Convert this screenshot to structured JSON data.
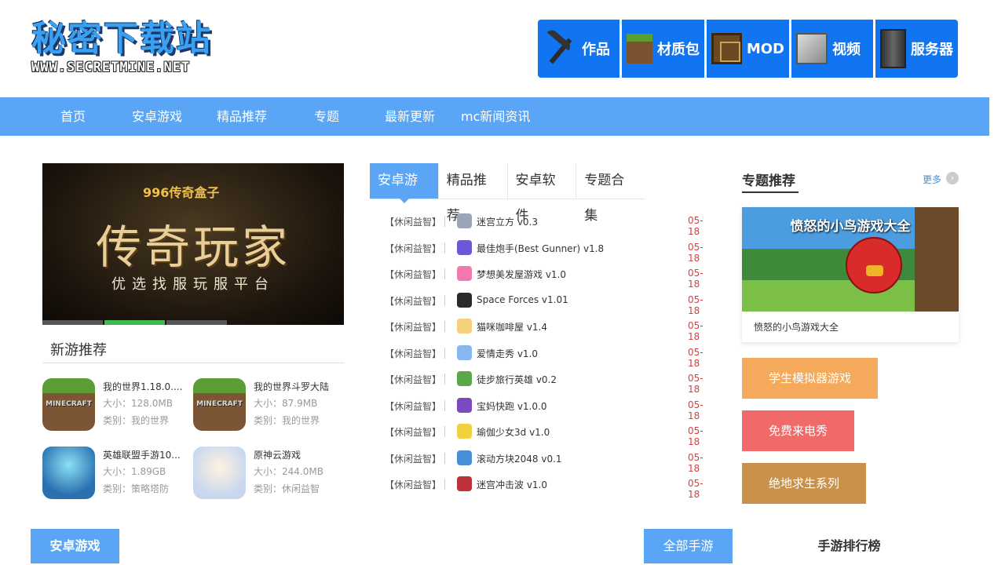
{
  "logo": {
    "main": "秘密下载站",
    "sub": "WWW.SECRETMINE.NET"
  },
  "top_categories": [
    {
      "label": "作品",
      "icon": "pickaxe-icon"
    },
    {
      "label": "材质包",
      "icon": "grass-block-icon"
    },
    {
      "label": "MOD",
      "icon": "book-icon"
    },
    {
      "label": "视频",
      "icon": "stone-block-icon"
    },
    {
      "label": "服务器",
      "icon": "server-icon"
    }
  ],
  "nav": [
    "首页",
    "安卓游戏",
    "精品推荐",
    "专题",
    "最新更新",
    "mc新闻资讯"
  ],
  "banner": {
    "brand": "996传奇盒子",
    "title": "传奇玩家",
    "subtitle": "优选找服玩服平台"
  },
  "new_games": {
    "title": "新游推荐",
    "items": [
      {
        "name": "我的世界1.18.0....",
        "size": "大小：128.0MB",
        "category": "类别：我的世界"
      },
      {
        "name": "我的世界斗罗大陆",
        "size": "大小：87.9MB",
        "category": "类别：我的世界"
      },
      {
        "name": "英雄联盟手游10...",
        "size": "大小：1.89GB",
        "category": "类别：策略塔防"
      },
      {
        "name": "原神云游戏",
        "size": "大小：244.0MB",
        "category": "类别：休闲益智"
      }
    ]
  },
  "tabs": [
    "安卓游戏",
    "精品推荐",
    "安卓软件",
    "专题合集"
  ],
  "game_list": [
    {
      "cat": "【休闲益智】",
      "title": "迷宫立方 v0.3",
      "date": "05-18",
      "color": "#9aa6b8"
    },
    {
      "cat": "【休闲益智】",
      "title": "最佳炮手(Best Gunner) v1.8",
      "date": "05-18",
      "color": "#6a5ad6"
    },
    {
      "cat": "【休闲益智】",
      "title": "梦想美发屋游戏 v1.0",
      "date": "05-18",
      "color": "#f07ab0"
    },
    {
      "cat": "【休闲益智】",
      "title": "Space Forces v1.01",
      "date": "05-18",
      "color": "#2a2a2a"
    },
    {
      "cat": "【休闲益智】",
      "title": "猫咪咖啡屋 v1.4",
      "date": "05-18",
      "color": "#f2d27a"
    },
    {
      "cat": "【休闲益智】",
      "title": "爱情走秀 v1.0",
      "date": "05-18",
      "color": "#8ab6f0"
    },
    {
      "cat": "【休闲益智】",
      "title": "徒步旅行英雄 v0.2",
      "date": "05-18",
      "color": "#5aa84a"
    },
    {
      "cat": "【休闲益智】",
      "title": "宝妈快跑 v1.0.0",
      "date": "05-18",
      "color": "#7a4ac0"
    },
    {
      "cat": "【休闲益智】",
      "title": "瑜伽少女3d v1.0",
      "date": "05-18",
      "color": "#f2d040"
    },
    {
      "cat": "【休闲益智】",
      "title": "滚动方块2048 v0.1",
      "date": "05-18",
      "color": "#4a8ed8"
    },
    {
      "cat": "【休闲益智】",
      "title": "迷宫冲击波 v1.0",
      "date": "05-18",
      "color": "#c0303a"
    }
  ],
  "topics": {
    "title": "专题推荐",
    "more": "更多",
    "card": {
      "image_text": "愤怒的小鸟游戏大全",
      "caption": "愤怒的小鸟游戏大全"
    },
    "tags": [
      {
        "label": "学生模拟器游戏",
        "color": "#f5a95b"
      },
      {
        "label": "免费来电秀",
        "color": "#f06a6a"
      },
      {
        "label": "绝地求生系列",
        "color": "#c8924a"
      }
    ]
  },
  "bottom": {
    "left_tab": "安卓游戏",
    "all_tab": "全部手游",
    "ranking": "手游排行榜"
  },
  "colors": {
    "nav": "#5aa5f5",
    "topcat": "#1174f0",
    "date": "#e03c3c"
  }
}
